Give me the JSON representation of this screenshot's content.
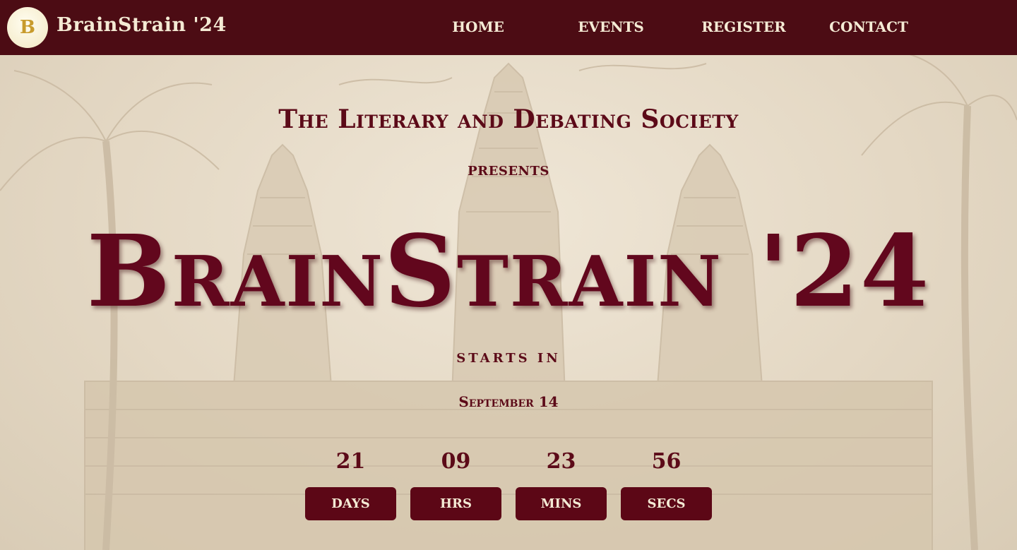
{
  "nav": {
    "brand": "BrainStrain '24",
    "logo_letter": "B",
    "links": [
      "HOME",
      "EVENTS",
      "REGISTER",
      "CONTACT"
    ]
  },
  "hero": {
    "society": "The Literary and Debating Society",
    "presents": "PRESENTS",
    "title": "BrainStrain '24",
    "starts_in": "STARTS IN",
    "date": "September 14"
  },
  "countdown": {
    "units": [
      {
        "value": "21",
        "label": "DAYS"
      },
      {
        "value": "09",
        "label": "HRS"
      },
      {
        "value": "23",
        "label": "MINS"
      },
      {
        "value": "56",
        "label": "SECS"
      }
    ]
  },
  "colors": {
    "nav_bg": "#4c0c14",
    "accent": "#62071d",
    "nav_text": "#f4ead4",
    "background": "#e6dccb"
  }
}
